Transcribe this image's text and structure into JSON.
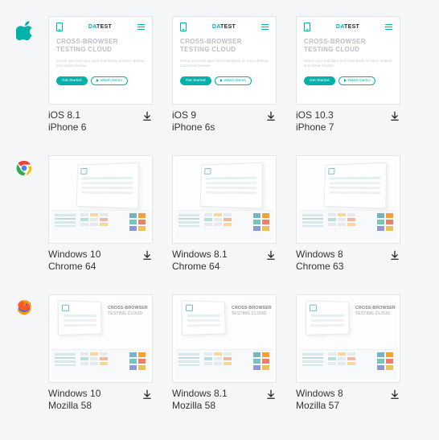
{
  "thumb_logo": {
    "teal": "DA",
    "dark": "TEST"
  },
  "thumb_heading_l1": "CROSS-BROWSER",
  "thumb_heading_l2": "TESTING CLOUD",
  "thumb_desc": "Ensure your web apps work seamlessly on every desktop and mobile browser.",
  "thumb_btn_primary": "Get Started",
  "thumb_btn_secondary": "Watch Demo",
  "rows": [
    {
      "platform": "apple",
      "items": [
        {
          "os": "iOS 8.1",
          "browser": "iPhone 6"
        },
        {
          "os": "iOS 9",
          "browser": "iPhone 6s"
        },
        {
          "os": "iOS 10.3",
          "browser": "iPhone 7"
        }
      ]
    },
    {
      "platform": "chrome",
      "items": [
        {
          "os": "Windows 10",
          "browser": "Chrome 64"
        },
        {
          "os": "Windows 8.1",
          "browser": "Chrome 64"
        },
        {
          "os": "Windows 8",
          "browser": "Chrome 63"
        }
      ]
    },
    {
      "platform": "firefox",
      "items": [
        {
          "os": "Windows 10",
          "browser": "Mozilla 58"
        },
        {
          "os": "Windows 8.1",
          "browser": "Mozilla 58"
        },
        {
          "os": "Windows 8",
          "browser": "Mozilla 57"
        }
      ]
    }
  ]
}
